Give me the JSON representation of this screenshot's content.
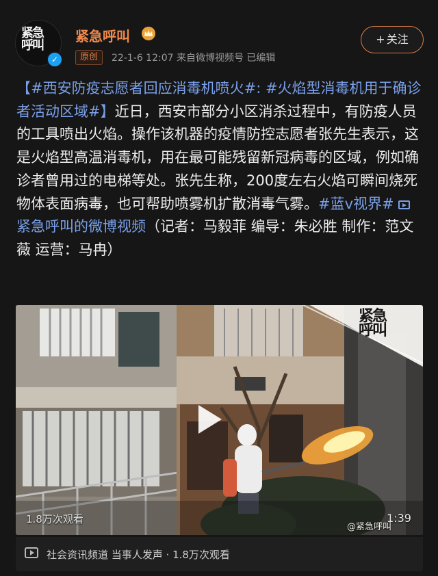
{
  "post": {
    "author_name": "紧急呼叫",
    "avatar_text": "紧急\n呼叫",
    "tag_label": "原创",
    "meta_text": "22-1-6 12:07  来自微博视频号  已编辑",
    "follow_label": "关注",
    "follow_plus": "+",
    "text_segments": [
      {
        "t": "【#西安防疫志愿者回应消毒机喷火#: #火焰型消毒机用于确诊者活动区域#】",
        "hl": true
      },
      {
        "t": "近日，西安市部分小区消杀过程中，有防疫人员的工具喷出火焰。操作该机器的疫情防控志愿者张先生表示，这是火焰型高温消毒机，用在最可能残留新冠病毒的区域，例如确诊者曾用过的电梯等处。张先生称，200度左右火焰可瞬间烧死物体表面病毒，也可帮助喷雾机扩散消毒气雾。",
        "hl": false
      },
      {
        "t": "#蓝v视界#",
        "hl": true
      },
      {
        "t": " ",
        "hl": false
      },
      {
        "t": "紧急呼叫的微博视频",
        "hl": true,
        "icon": "link-video-icon"
      },
      {
        "t": "（记者：马毅菲 编导：朱必胜 制作：范文薇 运营：马冉）",
        "hl": false
      }
    ]
  },
  "video": {
    "views_label": "1.8万次观看",
    "duration": "1:39",
    "watermark": "@紧急呼叫",
    "logo_text": "紧急\n呼叫"
  },
  "footer": {
    "text": "社会资讯频道 当事人发声 · 1.8万次观看"
  },
  "colors": {
    "accent": "#e07d45",
    "name": "#f2894c",
    "link": "#7aa0ea",
    "background": "#161616"
  }
}
